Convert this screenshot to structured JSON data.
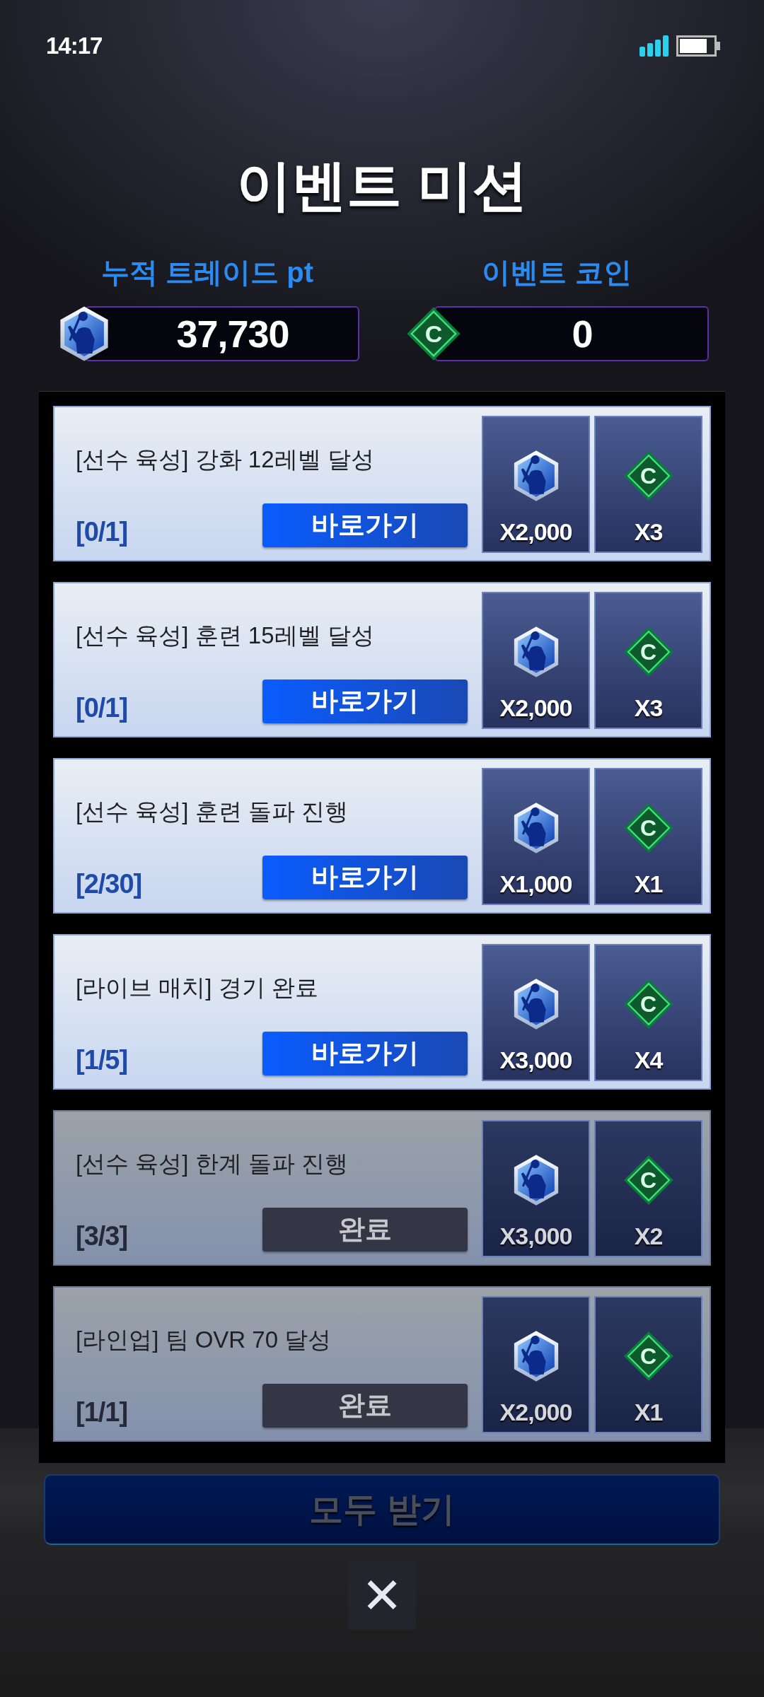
{
  "status_bar": {
    "time": "14:17"
  },
  "title": "이벤트 미션",
  "currencies": [
    {
      "kind": "trade_pt",
      "label": "누적 트레이드 pt",
      "value": "37,730"
    },
    {
      "kind": "coin",
      "label": "이벤트 코인",
      "value": "0",
      "symbol": "C"
    }
  ],
  "missions": [
    {
      "title": "[선수 육성] 강화 12레벨 달성",
      "progress": "[0/1]",
      "button": "바로가기",
      "completed": false,
      "rewards": [
        {
          "kind": "trade_pt",
          "amount": "X2,000"
        },
        {
          "kind": "coin",
          "symbol": "C",
          "amount": "X3"
        }
      ]
    },
    {
      "title": "[선수 육성] 훈련 15레벨 달성",
      "progress": "[0/1]",
      "button": "바로가기",
      "completed": false,
      "rewards": [
        {
          "kind": "trade_pt",
          "amount": "X2,000"
        },
        {
          "kind": "coin",
          "symbol": "C",
          "amount": "X3"
        }
      ]
    },
    {
      "title": "[선수 육성] 훈련 돌파 진행",
      "progress": "[2/30]",
      "button": "바로가기",
      "completed": false,
      "rewards": [
        {
          "kind": "trade_pt",
          "amount": "X1,000"
        },
        {
          "kind": "coin",
          "symbol": "C",
          "amount": "X1"
        }
      ]
    },
    {
      "title": "[라이브 매치] 경기 완료",
      "progress": "[1/5]",
      "button": "바로가기",
      "completed": false,
      "rewards": [
        {
          "kind": "trade_pt",
          "amount": "X3,000"
        },
        {
          "kind": "coin",
          "symbol": "C",
          "amount": "X4"
        }
      ]
    },
    {
      "title": "[선수 육성] 한계 돌파 진행",
      "progress": "[3/3]",
      "button": "완료",
      "completed": true,
      "rewards": [
        {
          "kind": "trade_pt",
          "amount": "X3,000"
        },
        {
          "kind": "coin",
          "symbol": "C",
          "amount": "X2"
        }
      ]
    },
    {
      "title": "[라인업] 팀 OVR 70 달성",
      "progress": "[1/1]",
      "button": "완료",
      "completed": true,
      "rewards": [
        {
          "kind": "trade_pt",
          "amount": "X2,000"
        },
        {
          "kind": "coin",
          "symbol": "C",
          "amount": "X1"
        }
      ]
    }
  ],
  "claim_all": {
    "label": "모두 받기",
    "disabled": true
  },
  "close": {
    "symbol": "✕"
  }
}
